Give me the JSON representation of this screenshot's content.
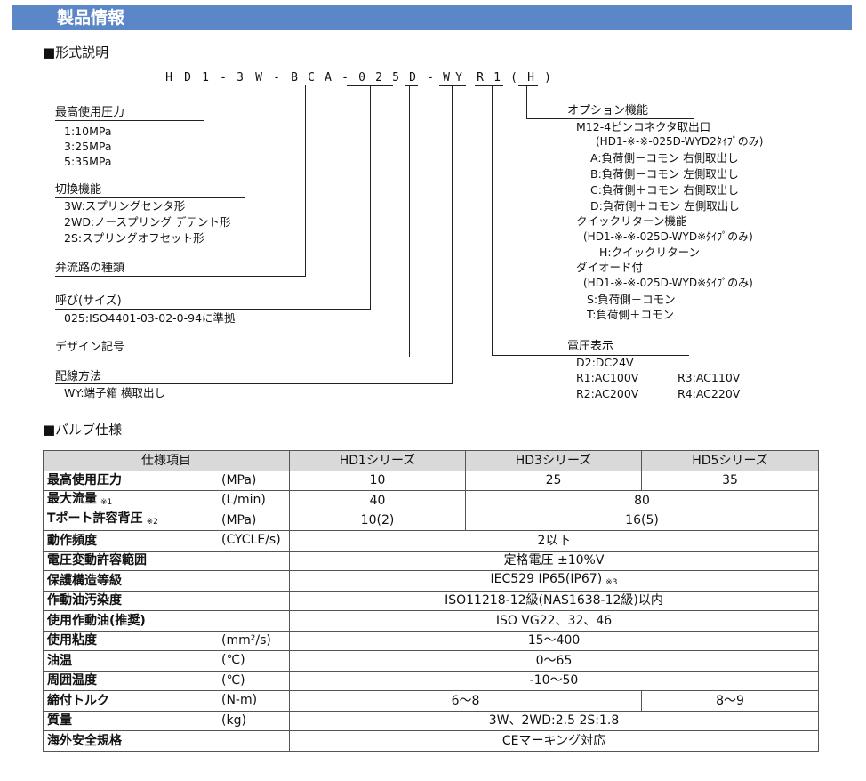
{
  "header": {
    "title": "製品情報"
  },
  "model_section": {
    "title": "■形式説明",
    "code_chars": [
      "H",
      "D",
      "1",
      "-",
      "3",
      "W",
      "-",
      "B",
      "C",
      "A",
      "-",
      "0",
      "2",
      "5",
      "D",
      "-",
      "W",
      "Y",
      "R",
      "1",
      "(",
      "H",
      ")"
    ],
    "left": {
      "pressure": {
        "title": "最高使用圧力",
        "items": [
          "1:10MPa",
          "3:25MPa",
          "5:35MPa"
        ]
      },
      "switching": {
        "title": "切換機能",
        "items": [
          "3W:スプリングセンタ形",
          "2WD:ノースプリング デテント形",
          "2S:スプリングオフセット形"
        ]
      },
      "flow_path": {
        "title": "弁流路の種類"
      },
      "size": {
        "title": "呼び(サイズ)",
        "items": [
          "025:ISO4401-03-02-0-94に準拠"
        ]
      },
      "design": {
        "title": "デザイン記号"
      },
      "wiring": {
        "title": "配線方法",
        "items": [
          "WY:端子箱 横取出し"
        ]
      }
    },
    "right": {
      "option": {
        "title": "オプション機能",
        "lines": [
          "M12-4ピンコネクタ取出口",
          "(HD1-※-※-025D-WYD2ﾀｲﾌﾟのみ)",
          "A:負荷側－コモン 右側取出し",
          "B:負荷側－コモン 左側取出し",
          "C:負荷側＋コモン 右側取出し",
          "D:負荷側＋コモン 左側取出し",
          "クイックリターン機能",
          "(HD1-※-※-025D-WYD※ﾀｲﾌﾟのみ)",
          "H:クイックリターン",
          "ダイオード付",
          "(HD1-※-※-025D-WYD※ﾀｲﾌﾟのみ)",
          "S:負荷側－コモン",
          "T:負荷側＋コモン"
        ]
      },
      "voltage": {
        "title": "電圧表示",
        "items": [
          "D2:DC24V",
          "R1:AC100V",
          "R3:AC110V",
          "R2:AC200V",
          "R4:AC220V"
        ]
      }
    }
  },
  "spec_section": {
    "title": "■バルブ仕様",
    "headers": [
      "仕様項目",
      "HD1シリーズ",
      "HD3シリーズ",
      "HD5シリーズ"
    ],
    "rows": [
      {
        "item": "最高使用圧力",
        "unit": "(MPa)",
        "note": "",
        "values": [
          "10",
          "25",
          "35"
        ]
      },
      {
        "item": "最大流量",
        "unit": "(L/min)",
        "note": "※1",
        "values": [
          "40",
          "80"
        ]
      },
      {
        "item": "Tポート許容背圧",
        "unit": "(MPa)",
        "note": "※2",
        "values": [
          "10(2)",
          "16(5)"
        ]
      },
      {
        "item": "動作頻度",
        "unit": "(CYCLE/s)",
        "note": "",
        "values": [
          "2以下"
        ]
      },
      {
        "item": "電圧変動許容範囲",
        "unit": "",
        "note": "",
        "values": [
          "定格電圧 ±10%V"
        ]
      },
      {
        "item": "保護構造等級",
        "unit": "",
        "note": "",
        "values": [
          "IEC529 IP65(IP67)"
        ],
        "value_note": "※3"
      },
      {
        "item": "作動油汚染度",
        "unit": "",
        "note": "",
        "values": [
          "ISO11218-12級(NAS1638-12級)以内"
        ]
      },
      {
        "item": "使用作動油(推奨)",
        "unit": "",
        "note": "",
        "values": [
          "ISO VG22、32、46"
        ]
      },
      {
        "item": "使用粘度",
        "unit": "(mm²/s)",
        "note": "",
        "values": [
          "15～400"
        ]
      },
      {
        "item": "油温",
        "unit": "(℃)",
        "note": "",
        "values": [
          "0～65"
        ]
      },
      {
        "item": "周囲温度",
        "unit": "(℃)",
        "note": "",
        "values": [
          "-10～50"
        ]
      },
      {
        "item": "締付トルク",
        "unit": "(N-m)",
        "note": "",
        "values": [
          "6～8",
          "8～9"
        ]
      },
      {
        "item": "質量",
        "unit": "(kg)",
        "note": "",
        "values": [
          "3W、2WD:2.5 2S:1.8"
        ]
      },
      {
        "item": "海外安全規格",
        "unit": "",
        "note": "",
        "values": [
          "CEマーキング対応"
        ]
      }
    ]
  }
}
